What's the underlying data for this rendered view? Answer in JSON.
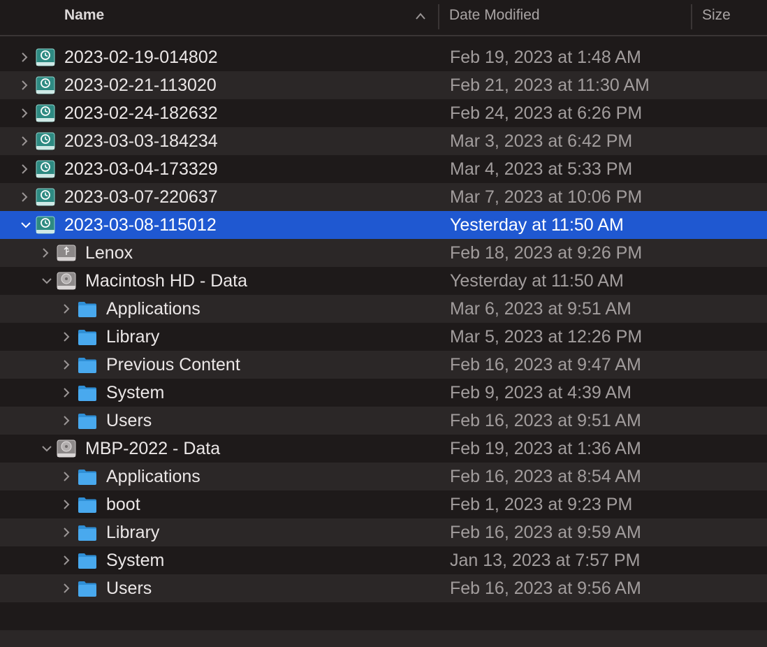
{
  "columns": {
    "name": "Name",
    "date_modified": "Date Modified",
    "size": "Size"
  },
  "rows": [
    {
      "name": "2023-02-19-014802",
      "date": "Feb 19, 2023 at 1:48 AM",
      "level": 0,
      "icon": "time-machine-backup-icon",
      "expanded": false
    },
    {
      "name": "2023-02-21-113020",
      "date": "Feb 21, 2023 at 11:30 AM",
      "level": 0,
      "icon": "time-machine-backup-icon",
      "expanded": false
    },
    {
      "name": "2023-02-24-182632",
      "date": "Feb 24, 2023 at 6:26 PM",
      "level": 0,
      "icon": "time-machine-backup-icon",
      "expanded": false
    },
    {
      "name": "2023-03-03-184234",
      "date": "Mar 3, 2023 at 6:42 PM",
      "level": 0,
      "icon": "time-machine-backup-icon",
      "expanded": false
    },
    {
      "name": "2023-03-04-173329",
      "date": "Mar 4, 2023 at 5:33 PM",
      "level": 0,
      "icon": "time-machine-backup-icon",
      "expanded": false
    },
    {
      "name": "2023-03-07-220637",
      "date": "Mar 7, 2023 at 10:06 PM",
      "level": 0,
      "icon": "time-machine-backup-icon",
      "expanded": false
    },
    {
      "name": "2023-03-08-115012",
      "date": "Yesterday at 11:50 AM",
      "level": 0,
      "icon": "time-machine-backup-icon",
      "expanded": true,
      "selected": true
    },
    {
      "name": "Lenox",
      "date": "Feb 18, 2023 at 9:26 PM",
      "level": 1,
      "icon": "usb-drive-icon",
      "expanded": false
    },
    {
      "name": "Macintosh HD - Data",
      "date": "Yesterday at 11:50 AM",
      "level": 1,
      "icon": "hard-drive-icon",
      "expanded": true
    },
    {
      "name": "Applications",
      "date": "Mar 6, 2023 at 9:51 AM",
      "level": 2,
      "icon": "folder-icon",
      "expanded": false
    },
    {
      "name": "Library",
      "date": "Mar 5, 2023 at 12:26 PM",
      "level": 2,
      "icon": "folder-icon",
      "expanded": false
    },
    {
      "name": "Previous Content",
      "date": "Feb 16, 2023 at 9:47 AM",
      "level": 2,
      "icon": "folder-icon",
      "expanded": false
    },
    {
      "name": "System",
      "date": "Feb 9, 2023 at 4:39 AM",
      "level": 2,
      "icon": "folder-icon",
      "expanded": false
    },
    {
      "name": "Users",
      "date": "Feb 16, 2023 at 9:51 AM",
      "level": 2,
      "icon": "folder-icon",
      "expanded": false
    },
    {
      "name": "MBP-2022 - Data",
      "date": "Feb 19, 2023 at 1:36 AM",
      "level": 1,
      "icon": "hard-drive-icon",
      "expanded": true
    },
    {
      "name": "Applications",
      "date": "Feb 16, 2023 at 8:54 AM",
      "level": 2,
      "icon": "folder-icon",
      "expanded": false
    },
    {
      "name": "boot",
      "date": "Feb 1, 2023 at 9:23 PM",
      "level": 2,
      "icon": "folder-icon",
      "expanded": false
    },
    {
      "name": "Library",
      "date": "Feb 16, 2023 at 9:59 AM",
      "level": 2,
      "icon": "folder-icon",
      "expanded": false
    },
    {
      "name": "System",
      "date": "Jan 13, 2023 at 7:57 PM",
      "level": 2,
      "icon": "folder-icon",
      "expanded": false
    },
    {
      "name": "Users",
      "date": "Feb 16, 2023 at 9:56 AM",
      "level": 2,
      "icon": "folder-icon",
      "expanded": false
    }
  ],
  "colors": {
    "background": "#1e1a1a",
    "alt_row": "#2b2727",
    "selection": "#1f58d1",
    "folder": "#49a9ee",
    "backup_icon": "#2e8a82"
  }
}
